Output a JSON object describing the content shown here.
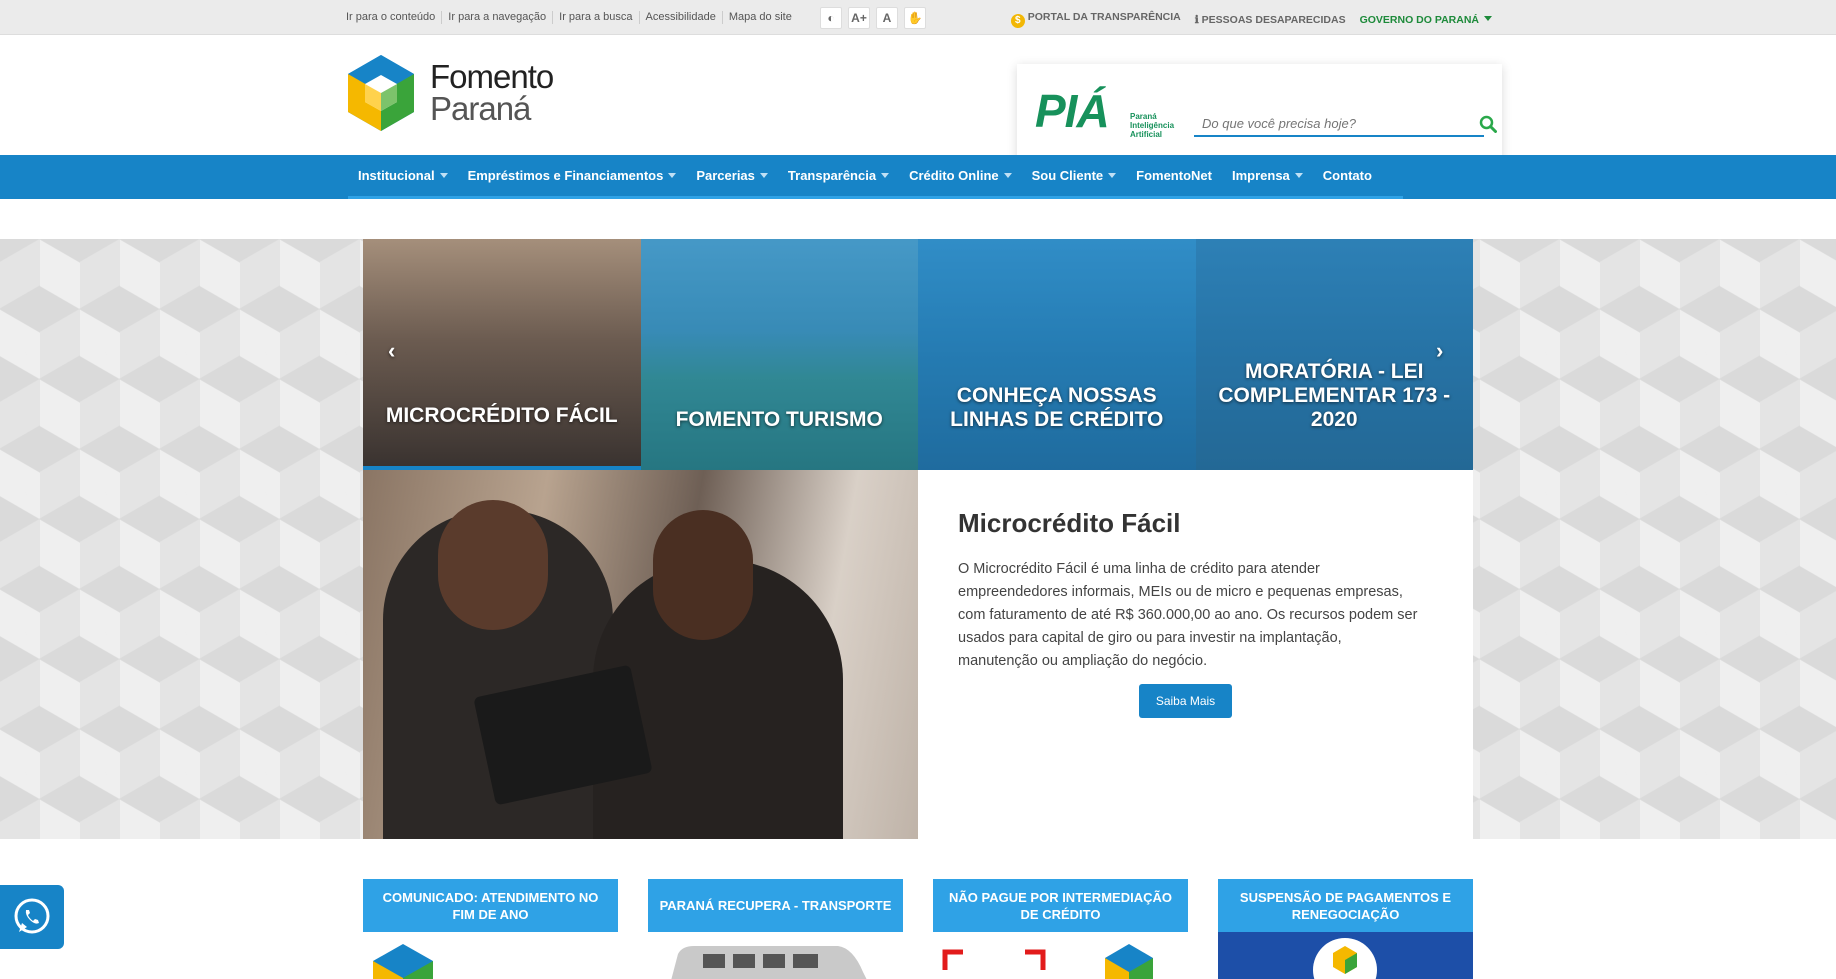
{
  "topbar": {
    "links": [
      "Ir para o conteúdo",
      "Ir para a navegação",
      "Ir para a busca",
      "Acessibilidade",
      "Mapa do site"
    ],
    "tools": [
      "◐",
      "A+",
      "A",
      "✋"
    ],
    "portal": "PORTAL DA TRANSPARÊNCIA",
    "desaparecidas": "PESSOAS DESAPARECIDAS",
    "governo": "GOVERNO DO PARANÁ"
  },
  "header": {
    "logo_line1": "Fomento",
    "logo_line2": "Paraná",
    "pia": {
      "word": "PIÁ",
      "sub1": "Paraná",
      "sub2": "Inteligência",
      "sub3": "Artificial"
    },
    "search_placeholder": "Do que você precisa hoje?"
  },
  "nav": {
    "items": [
      {
        "label": "Institucional",
        "dropdown": true
      },
      {
        "label": "Empréstimos e Financiamentos",
        "dropdown": true
      },
      {
        "label": "Parcerias",
        "dropdown": true
      },
      {
        "label": "Transparência",
        "dropdown": true
      },
      {
        "label": "Crédito Online",
        "dropdown": true
      },
      {
        "label": "Sou Cliente",
        "dropdown": true
      },
      {
        "label": "FomentoNet",
        "dropdown": false
      },
      {
        "label": "Imprensa",
        "dropdown": true
      },
      {
        "label": "Contato",
        "dropdown": false
      }
    ]
  },
  "carousel": {
    "prev": "‹",
    "next": "›",
    "slides": [
      {
        "title": "MICROCRÉDITO FÁCIL"
      },
      {
        "title": "FOMENTO TURISMO"
      },
      {
        "title": "CONHEÇA NOSSAS LINHAS DE CRÉDITO"
      },
      {
        "title": "MORATÓRIA - LEI COMPLEMENTAR 173 - 2020"
      }
    ]
  },
  "feature": {
    "title": "Microcrédito Fácil",
    "text": "O Microcrédito Fácil é uma linha de crédito para atender empreendedores informais, MEIs ou de micro e pequenas empresas, com faturamento de até R$ 360.000,00 ao ano. Os recursos podem ser usados para capital de giro ou para investir na implantação, manutenção ou ampliação do negócio.",
    "button": "Saiba Mais"
  },
  "cards": [
    {
      "title": "COMUNICADO: ATENDIMENTO NO FIM DE ANO"
    },
    {
      "title": "PARANÁ RECUPERA - TRANSPORTE"
    },
    {
      "title": "NÃO PAGUE POR INTERMEDIAÇÃO DE CRÉDITO"
    },
    {
      "title": "SUSPENSÃO DE PAGAMENTOS E RENEGOCIAÇÃO"
    }
  ],
  "colors": {
    "primary": "#1784c7",
    "primary_light": "#2fa2e6",
    "green": "#17915b"
  }
}
